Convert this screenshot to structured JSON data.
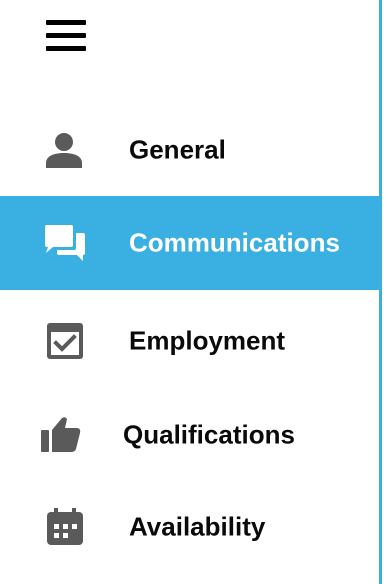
{
  "menu": {
    "toggle_icon": "hamburger-menu-icon"
  },
  "nav": {
    "items": [
      {
        "label": "General",
        "icon": "person-icon",
        "active": false
      },
      {
        "label": "Communications",
        "icon": "chat-bubbles-icon",
        "active": true
      },
      {
        "label": "Employment",
        "icon": "calendar-check-icon",
        "active": false
      },
      {
        "label": "Qualifications",
        "icon": "thumbs-up-icon",
        "active": false
      },
      {
        "label": "Availability",
        "icon": "calendar-icon",
        "active": false
      }
    ]
  },
  "colors": {
    "accent": "#3ab0e2",
    "icon": "#5a5a5a",
    "text": "#0a0a0a",
    "active_text": "#ffffff"
  }
}
